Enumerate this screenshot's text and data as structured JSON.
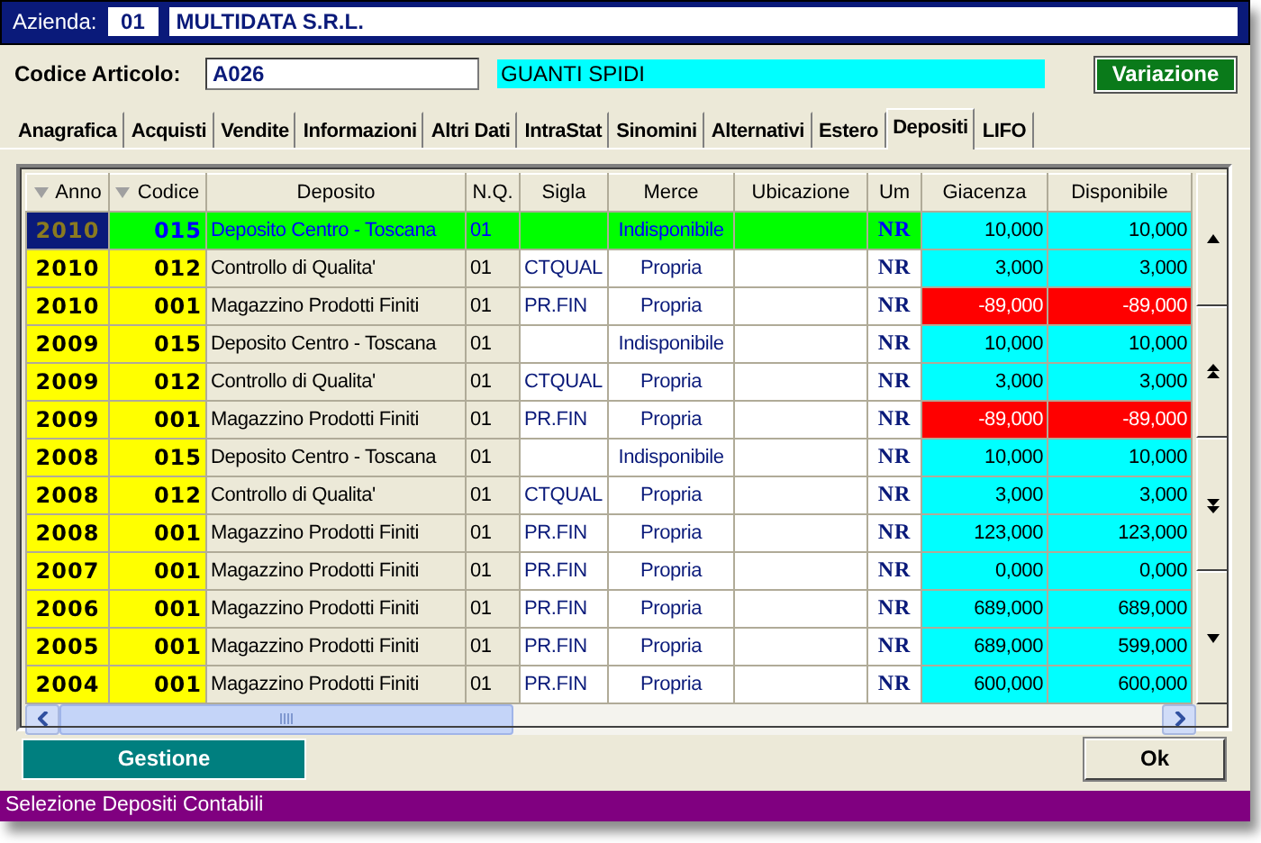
{
  "header": {
    "label": "Azienda:",
    "company_code": "01",
    "company_name": "MULTIDATA S.R.L."
  },
  "article": {
    "label": "Codice Articolo:",
    "code": "A026",
    "description": "GUANTI SPIDI",
    "action": "Variazione"
  },
  "tabs": [
    {
      "label": "Anagrafica",
      "selected": false
    },
    {
      "label": "Acquisti",
      "selected": false
    },
    {
      "label": "Vendite",
      "selected": false
    },
    {
      "label": "Informazioni",
      "selected": false
    },
    {
      "label": "Altri Dati",
      "selected": false
    },
    {
      "label": "IntraStat",
      "selected": false
    },
    {
      "label": "Sinomini",
      "selected": false
    },
    {
      "label": "Alternativi",
      "selected": false
    },
    {
      "label": "Estero",
      "selected": false
    },
    {
      "label": "Depositi",
      "selected": true
    },
    {
      "label": "LIFO",
      "selected": false
    }
  ],
  "table": {
    "columns": [
      {
        "label": "Anno",
        "sortable": true
      },
      {
        "label": "Codice",
        "sortable": true
      },
      {
        "label": "Deposito",
        "sortable": false
      },
      {
        "label": "N.Q.",
        "sortable": false
      },
      {
        "label": "Sigla",
        "sortable": false
      },
      {
        "label": "Merce",
        "sortable": false
      },
      {
        "label": "Ubicazione",
        "sortable": false
      },
      {
        "label": "Um",
        "sortable": false
      },
      {
        "label": "Giacenza",
        "sortable": false
      },
      {
        "label": "Disponibile",
        "sortable": false
      }
    ],
    "rows": [
      {
        "cells": [
          "2010",
          "015",
          "Deposito Centro - Toscana",
          "01",
          "",
          "Indisponibile",
          "",
          "NR",
          "10,000",
          "10,000"
        ],
        "selected": true,
        "negative": false
      },
      {
        "cells": [
          "2010",
          "012",
          "Controllo di Qualita'",
          "01",
          "CTQUAL",
          "Propria",
          "",
          "NR",
          "3,000",
          "3,000"
        ],
        "selected": false,
        "negative": false
      },
      {
        "cells": [
          "2010",
          "001",
          "Magazzino Prodotti Finiti",
          "01",
          "PR.FIN",
          "Propria",
          "",
          "NR",
          "-89,000",
          "-89,000"
        ],
        "selected": false,
        "negative": true
      },
      {
        "cells": [
          "2009",
          "015",
          "Deposito Centro - Toscana",
          "01",
          "",
          "Indisponibile",
          "",
          "NR",
          "10,000",
          "10,000"
        ],
        "selected": false,
        "negative": false
      },
      {
        "cells": [
          "2009",
          "012",
          "Controllo di Qualita'",
          "01",
          "CTQUAL",
          "Propria",
          "",
          "NR",
          "3,000",
          "3,000"
        ],
        "selected": false,
        "negative": false
      },
      {
        "cells": [
          "2009",
          "001",
          "Magazzino Prodotti Finiti",
          "01",
          "PR.FIN",
          "Propria",
          "",
          "NR",
          "-89,000",
          "-89,000"
        ],
        "selected": false,
        "negative": true
      },
      {
        "cells": [
          "2008",
          "015",
          "Deposito Centro - Toscana",
          "01",
          "",
          "Indisponibile",
          "",
          "NR",
          "10,000",
          "10,000"
        ],
        "selected": false,
        "negative": false
      },
      {
        "cells": [
          "2008",
          "012",
          "Controllo di Qualita'",
          "01",
          "CTQUAL",
          "Propria",
          "",
          "NR",
          "3,000",
          "3,000"
        ],
        "selected": false,
        "negative": false
      },
      {
        "cells": [
          "2008",
          "001",
          "Magazzino Prodotti Finiti",
          "01",
          "PR.FIN",
          "Propria",
          "",
          "NR",
          "123,000",
          "123,000"
        ],
        "selected": false,
        "negative": false
      },
      {
        "cells": [
          "2007",
          "001",
          "Magazzino Prodotti Finiti",
          "01",
          "PR.FIN",
          "Propria",
          "",
          "NR",
          "0,000",
          "0,000"
        ],
        "selected": false,
        "negative": false
      },
      {
        "cells": [
          "2006",
          "001",
          "Magazzino Prodotti Finiti",
          "01",
          "PR.FIN",
          "Propria",
          "",
          "NR",
          "689,000",
          "689,000"
        ],
        "selected": false,
        "negative": false
      },
      {
        "cells": [
          "2005",
          "001",
          "Magazzino Prodotti Finiti",
          "01",
          "PR.FIN",
          "Propria",
          "",
          "NR",
          "689,000",
          "599,000"
        ],
        "selected": false,
        "negative": false
      },
      {
        "cells": [
          "2004",
          "001",
          "Magazzino Prodotti Finiti",
          "01",
          "PR.FIN",
          "Propria",
          "",
          "NR",
          "600,000",
          "600,000"
        ],
        "selected": false,
        "negative": false
      }
    ]
  },
  "buttons": {
    "manage": "Gestione",
    "ok": "Ok"
  },
  "status_bar": "Selezione Depositi Contabili"
}
